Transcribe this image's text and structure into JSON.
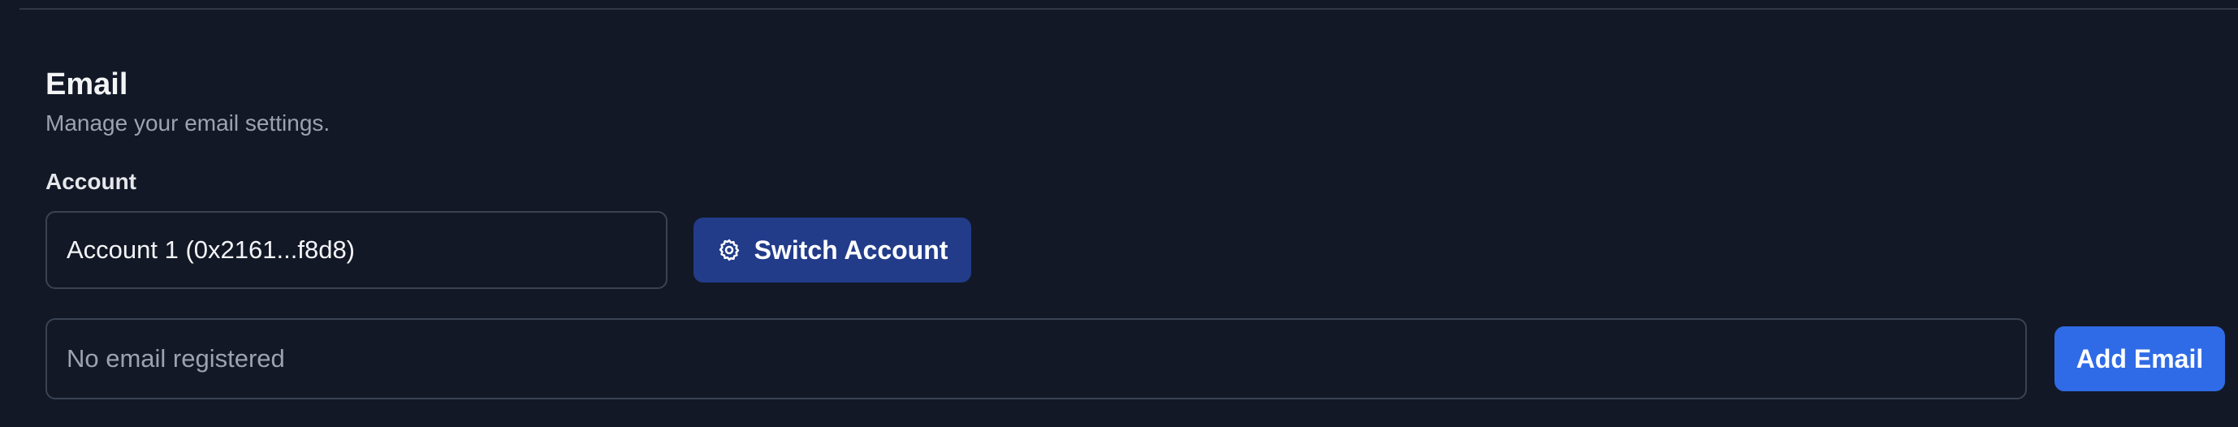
{
  "email_section": {
    "title": "Email",
    "subtitle": "Manage your email settings."
  },
  "account": {
    "label": "Account",
    "current_value": "Account 1 (0x2161...f8d8)",
    "switch_button_label": "Switch Account",
    "switch_button_icon": "gear-icon"
  },
  "email": {
    "status_text": "No email registered",
    "add_button_label": "Add Email"
  },
  "colors": {
    "background": "#121826",
    "switch_button": "#223c8a",
    "add_button": "#2f6be6",
    "border": "#3a4354"
  }
}
